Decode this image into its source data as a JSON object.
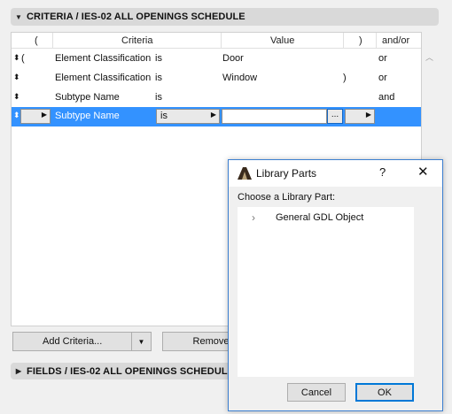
{
  "criteria_section": {
    "title": "CRITERIA / IES-02 ALL OPENINGS SCHEDULE",
    "expanded": true
  },
  "fields_section": {
    "title": "FIELDS / IES-02 ALL OPENINGS SCHEDULE",
    "expanded": false
  },
  "table": {
    "headers": {
      "open_paren": "(",
      "criteria": "Criteria",
      "value": "Value",
      "close_paren": ")",
      "andor": "and/or"
    },
    "rows": [
      {
        "open_paren": "(",
        "criteria": "Element Classification",
        "operator": "is",
        "value": "Door",
        "close_paren": "",
        "andor": "or"
      },
      {
        "open_paren": "",
        "criteria": "Element Classification",
        "operator": "is",
        "value": "Window",
        "close_paren": ")",
        "andor": "or"
      },
      {
        "open_paren": "",
        "criteria": "Subtype Name",
        "operator": "is",
        "value": "",
        "close_paren": "",
        "andor": "and"
      }
    ],
    "selected_row": {
      "criteria": "Subtype Name",
      "operator": "is",
      "value": "",
      "browse": "..."
    }
  },
  "buttons": {
    "add_criteria": "Add Criteria...",
    "remove": "Remove"
  },
  "dialog": {
    "title": "Library Parts",
    "help": "?",
    "close": "✕",
    "prompt": "Choose a Library Part:",
    "tree": [
      {
        "label": "General GDL Object",
        "expanded": false
      }
    ],
    "cancel": "Cancel",
    "ok": "OK"
  },
  "colors": {
    "selection": "#3392ff",
    "dialog_border": "#3c7fd0",
    "ok_border": "#0078d7"
  }
}
